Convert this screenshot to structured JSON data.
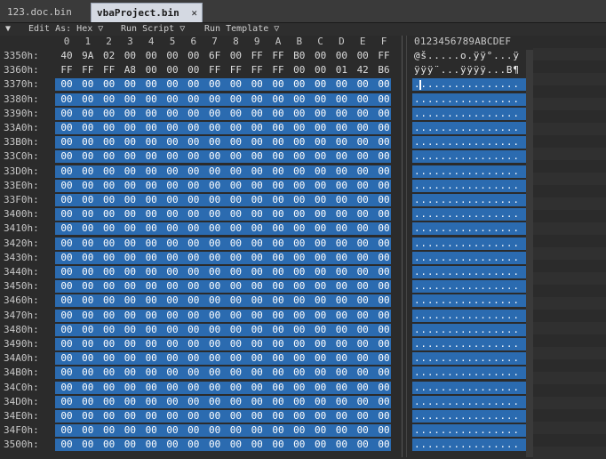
{
  "tabs": [
    {
      "label": "123.doc.bin",
      "active": false
    },
    {
      "label": "vbaProject.bin",
      "active": true
    }
  ],
  "toolbar": {
    "collapse_glyph": "▼",
    "edit_as": "Edit As: Hex ▽",
    "run_script": "Run Script ▽",
    "run_template": "Run Template ▽"
  },
  "columns": [
    "0",
    "1",
    "2",
    "3",
    "4",
    "5",
    "6",
    "7",
    "8",
    "9",
    "A",
    "B",
    "C",
    "D",
    "E",
    "F"
  ],
  "ascii_header": "0123456789ABCDEF",
  "rows": [
    {
      "addr": "3350h:",
      "bytes": [
        "40",
        "9A",
        "02",
        "00",
        "00",
        "00",
        "00",
        "6F",
        "00",
        "FF",
        "FF",
        "B0",
        "00",
        "00",
        "00",
        "FF"
      ],
      "ascii": "@š.....o.ÿÿ°...ÿ"
    },
    {
      "addr": "3360h:",
      "bytes": [
        "FF",
        "FF",
        "FF",
        "A8",
        "00",
        "00",
        "00",
        "FF",
        "FF",
        "FF",
        "FF",
        "00",
        "00",
        "01",
        "42",
        "B6"
      ],
      "ascii": "ÿÿÿ¨...ÿÿÿÿ...B¶"
    },
    {
      "addr": "3370h:",
      "bytes": [
        "00",
        "00",
        "00",
        "00",
        "00",
        "00",
        "00",
        "00",
        "00",
        "00",
        "00",
        "00",
        "00",
        "00",
        "00",
        "00"
      ],
      "ascii": "................"
    },
    {
      "addr": "3380h:",
      "bytes": [
        "00",
        "00",
        "00",
        "00",
        "00",
        "00",
        "00",
        "00",
        "00",
        "00",
        "00",
        "00",
        "00",
        "00",
        "00",
        "00"
      ],
      "ascii": "................"
    },
    {
      "addr": "3390h:",
      "bytes": [
        "00",
        "00",
        "00",
        "00",
        "00",
        "00",
        "00",
        "00",
        "00",
        "00",
        "00",
        "00",
        "00",
        "00",
        "00",
        "00"
      ],
      "ascii": "................"
    },
    {
      "addr": "33A0h:",
      "bytes": [
        "00",
        "00",
        "00",
        "00",
        "00",
        "00",
        "00",
        "00",
        "00",
        "00",
        "00",
        "00",
        "00",
        "00",
        "00",
        "00"
      ],
      "ascii": "................"
    },
    {
      "addr": "33B0h:",
      "bytes": [
        "00",
        "00",
        "00",
        "00",
        "00",
        "00",
        "00",
        "00",
        "00",
        "00",
        "00",
        "00",
        "00",
        "00",
        "00",
        "00"
      ],
      "ascii": "................"
    },
    {
      "addr": "33C0h:",
      "bytes": [
        "00",
        "00",
        "00",
        "00",
        "00",
        "00",
        "00",
        "00",
        "00",
        "00",
        "00",
        "00",
        "00",
        "00",
        "00",
        "00"
      ],
      "ascii": "................"
    },
    {
      "addr": "33D0h:",
      "bytes": [
        "00",
        "00",
        "00",
        "00",
        "00",
        "00",
        "00",
        "00",
        "00",
        "00",
        "00",
        "00",
        "00",
        "00",
        "00",
        "00"
      ],
      "ascii": "................"
    },
    {
      "addr": "33E0h:",
      "bytes": [
        "00",
        "00",
        "00",
        "00",
        "00",
        "00",
        "00",
        "00",
        "00",
        "00",
        "00",
        "00",
        "00",
        "00",
        "00",
        "00"
      ],
      "ascii": "................"
    },
    {
      "addr": "33F0h:",
      "bytes": [
        "00",
        "00",
        "00",
        "00",
        "00",
        "00",
        "00",
        "00",
        "00",
        "00",
        "00",
        "00",
        "00",
        "00",
        "00",
        "00"
      ],
      "ascii": "................"
    },
    {
      "addr": "3400h:",
      "bytes": [
        "00",
        "00",
        "00",
        "00",
        "00",
        "00",
        "00",
        "00",
        "00",
        "00",
        "00",
        "00",
        "00",
        "00",
        "00",
        "00"
      ],
      "ascii": "................"
    },
    {
      "addr": "3410h:",
      "bytes": [
        "00",
        "00",
        "00",
        "00",
        "00",
        "00",
        "00",
        "00",
        "00",
        "00",
        "00",
        "00",
        "00",
        "00",
        "00",
        "00"
      ],
      "ascii": "................"
    },
    {
      "addr": "3420h:",
      "bytes": [
        "00",
        "00",
        "00",
        "00",
        "00",
        "00",
        "00",
        "00",
        "00",
        "00",
        "00",
        "00",
        "00",
        "00",
        "00",
        "00"
      ],
      "ascii": "................"
    },
    {
      "addr": "3430h:",
      "bytes": [
        "00",
        "00",
        "00",
        "00",
        "00",
        "00",
        "00",
        "00",
        "00",
        "00",
        "00",
        "00",
        "00",
        "00",
        "00",
        "00"
      ],
      "ascii": "................"
    },
    {
      "addr": "3440h:",
      "bytes": [
        "00",
        "00",
        "00",
        "00",
        "00",
        "00",
        "00",
        "00",
        "00",
        "00",
        "00",
        "00",
        "00",
        "00",
        "00",
        "00"
      ],
      "ascii": "................"
    },
    {
      "addr": "3450h:",
      "bytes": [
        "00",
        "00",
        "00",
        "00",
        "00",
        "00",
        "00",
        "00",
        "00",
        "00",
        "00",
        "00",
        "00",
        "00",
        "00",
        "00"
      ],
      "ascii": "................"
    },
    {
      "addr": "3460h:",
      "bytes": [
        "00",
        "00",
        "00",
        "00",
        "00",
        "00",
        "00",
        "00",
        "00",
        "00",
        "00",
        "00",
        "00",
        "00",
        "00",
        "00"
      ],
      "ascii": "................"
    },
    {
      "addr": "3470h:",
      "bytes": [
        "00",
        "00",
        "00",
        "00",
        "00",
        "00",
        "00",
        "00",
        "00",
        "00",
        "00",
        "00",
        "00",
        "00",
        "00",
        "00"
      ],
      "ascii": "................"
    },
    {
      "addr": "3480h:",
      "bytes": [
        "00",
        "00",
        "00",
        "00",
        "00",
        "00",
        "00",
        "00",
        "00",
        "00",
        "00",
        "00",
        "00",
        "00",
        "00",
        "00"
      ],
      "ascii": "................"
    },
    {
      "addr": "3490h:",
      "bytes": [
        "00",
        "00",
        "00",
        "00",
        "00",
        "00",
        "00",
        "00",
        "00",
        "00",
        "00",
        "00",
        "00",
        "00",
        "00",
        "00"
      ],
      "ascii": "................"
    },
    {
      "addr": "34A0h:",
      "bytes": [
        "00",
        "00",
        "00",
        "00",
        "00",
        "00",
        "00",
        "00",
        "00",
        "00",
        "00",
        "00",
        "00",
        "00",
        "00",
        "00"
      ],
      "ascii": "................"
    },
    {
      "addr": "34B0h:",
      "bytes": [
        "00",
        "00",
        "00",
        "00",
        "00",
        "00",
        "00",
        "00",
        "00",
        "00",
        "00",
        "00",
        "00",
        "00",
        "00",
        "00"
      ],
      "ascii": "................"
    },
    {
      "addr": "34C0h:",
      "bytes": [
        "00",
        "00",
        "00",
        "00",
        "00",
        "00",
        "00",
        "00",
        "00",
        "00",
        "00",
        "00",
        "00",
        "00",
        "00",
        "00"
      ],
      "ascii": "................"
    },
    {
      "addr": "34D0h:",
      "bytes": [
        "00",
        "00",
        "00",
        "00",
        "00",
        "00",
        "00",
        "00",
        "00",
        "00",
        "00",
        "00",
        "00",
        "00",
        "00",
        "00"
      ],
      "ascii": "................"
    },
    {
      "addr": "34E0h:",
      "bytes": [
        "00",
        "00",
        "00",
        "00",
        "00",
        "00",
        "00",
        "00",
        "00",
        "00",
        "00",
        "00",
        "00",
        "00",
        "00",
        "00"
      ],
      "ascii": "................"
    },
    {
      "addr": "34F0h:",
      "bytes": [
        "00",
        "00",
        "00",
        "00",
        "00",
        "00",
        "00",
        "00",
        "00",
        "00",
        "00",
        "00",
        "00",
        "00",
        "00",
        "00"
      ],
      "ascii": "................"
    },
    {
      "addr": "3500h:",
      "bytes": [
        "00",
        "00",
        "00",
        "00",
        "00",
        "00",
        "00",
        "00",
        "00",
        "00",
        "00",
        "00",
        "00",
        "00",
        "00",
        "00"
      ],
      "ascii": "................"
    }
  ],
  "selection_start_row": 2,
  "colors": {
    "selection": "#2b6bb0",
    "background": "#2b2b2b",
    "active_tab": "#d4d9e2"
  }
}
